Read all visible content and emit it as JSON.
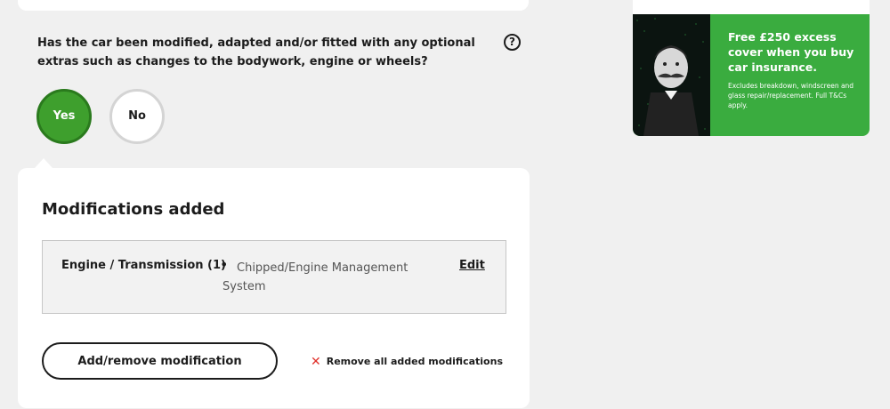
{
  "question": {
    "text": "Has the car been modified, adapted and/or fitted with any optional extras such as changes to the bodywork, engine or wheels?",
    "help_icon": "?"
  },
  "options": {
    "yes": "Yes",
    "no": "No",
    "selected": "Yes"
  },
  "modifications": {
    "title": "Modifications added",
    "items": [
      {
        "category": "Engine / Transmission (1)",
        "bullet": "•",
        "description": "Chipped/Engine Management System",
        "edit_label": "Edit"
      }
    ],
    "add_button": "Add/remove modification",
    "remove_all": "Remove all added modifications"
  },
  "promo": {
    "headline": "Free £250 excess cover when you buy car insurance.",
    "small_print": "Excludes breakdown, windscreen and glass repair/replacement. Full T&Cs apply."
  },
  "colors": {
    "selected_green": "#3e9f2d",
    "promo_green": "#3aac3f",
    "remove_icon": "#e0312b",
    "background": "#f0f0f0"
  },
  "icons": {
    "help": "question-circle-icon",
    "remove": "close-x-icon"
  }
}
